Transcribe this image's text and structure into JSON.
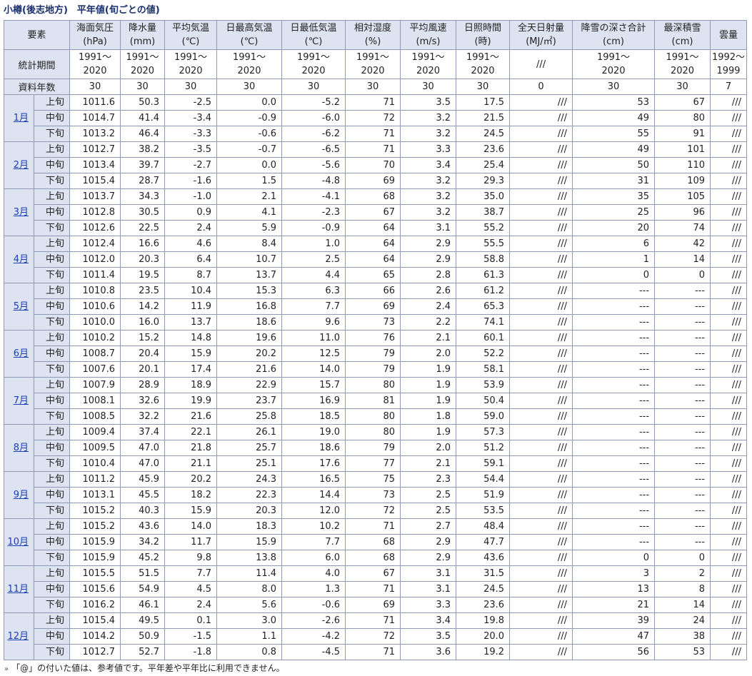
{
  "title": "小樽(後志地方)　平年値(旬ごとの値)",
  "header": {
    "element_label": "要素",
    "columns": [
      [
        "海面気圧",
        "(hPa)"
      ],
      [
        "降水量",
        "(mm)"
      ],
      [
        "平均気温",
        "(℃)"
      ],
      [
        "日最高気温",
        "(℃)"
      ],
      [
        "日最低気温",
        "(℃)"
      ],
      [
        "相対湿度",
        "(%)"
      ],
      [
        "平均風速",
        "(m/s)"
      ],
      [
        "日照時間",
        "(時)"
      ],
      [
        "全天日射量",
        "(MJ/㎡)"
      ],
      [
        "降雪の深さ合計",
        "(cm)"
      ],
      [
        "最深積雪",
        "(cm)"
      ],
      [
        "雲量",
        ""
      ]
    ]
  },
  "period": {
    "label": "統計期間",
    "values": [
      [
        "1991～",
        "2020"
      ],
      [
        "1991～",
        "2020"
      ],
      [
        "1991～",
        "2020"
      ],
      [
        "1991～",
        "2020"
      ],
      [
        "1991～",
        "2020"
      ],
      [
        "1991～",
        "2020"
      ],
      [
        "1991～",
        "2020"
      ],
      [
        "1991～",
        "2020"
      ],
      [
        "///",
        ""
      ],
      [
        "1991～",
        "2020"
      ],
      [
        "1991～",
        "2020"
      ],
      [
        "1992～",
        "1999"
      ]
    ]
  },
  "years": {
    "label": "資料年数",
    "values": [
      "30",
      "30",
      "30",
      "30",
      "30",
      "30",
      "30",
      "30",
      "0",
      "30",
      "30",
      "7"
    ]
  },
  "dekads": [
    "上旬",
    "中旬",
    "下旬"
  ],
  "months": [
    {
      "label": "1月",
      "rows": [
        [
          "1011.6",
          "50.3",
          "-2.5",
          "0.0",
          "-5.2",
          "71",
          "3.5",
          "17.5",
          "///",
          "53",
          "67",
          "///"
        ],
        [
          "1014.7",
          "41.4",
          "-3.4",
          "-0.9",
          "-6.0",
          "72",
          "3.2",
          "21.5",
          "///",
          "49",
          "80",
          "///"
        ],
        [
          "1013.2",
          "46.4",
          "-3.3",
          "-0.6",
          "-6.2",
          "71",
          "3.2",
          "24.5",
          "///",
          "55",
          "91",
          "///"
        ]
      ]
    },
    {
      "label": "2月",
      "rows": [
        [
          "1012.7",
          "38.2",
          "-3.5",
          "-0.7",
          "-6.5",
          "71",
          "3.3",
          "23.6",
          "///",
          "49",
          "101",
          "///"
        ],
        [
          "1013.4",
          "39.7",
          "-2.7",
          "0.0",
          "-5.6",
          "70",
          "3.4",
          "25.4",
          "///",
          "50",
          "110",
          "///"
        ],
        [
          "1015.4",
          "28.7",
          "-1.6",
          "1.5",
          "-4.8",
          "69",
          "3.2",
          "29.3",
          "///",
          "31",
          "109",
          "///"
        ]
      ]
    },
    {
      "label": "3月",
      "rows": [
        [
          "1013.7",
          "34.3",
          "-1.0",
          "2.1",
          "-4.1",
          "68",
          "3.2",
          "35.0",
          "///",
          "35",
          "105",
          "///"
        ],
        [
          "1012.8",
          "30.5",
          "0.9",
          "4.1",
          "-2.3",
          "67",
          "3.2",
          "38.7",
          "///",
          "25",
          "96",
          "///"
        ],
        [
          "1012.6",
          "22.5",
          "2.4",
          "5.9",
          "-0.9",
          "64",
          "3.1",
          "55.2",
          "///",
          "20",
          "74",
          "///"
        ]
      ]
    },
    {
      "label": "4月",
      "rows": [
        [
          "1012.4",
          "16.6",
          "4.6",
          "8.4",
          "1.0",
          "64",
          "2.9",
          "55.5",
          "///",
          "6",
          "42",
          "///"
        ],
        [
          "1012.0",
          "20.3",
          "6.4",
          "10.7",
          "2.5",
          "64",
          "2.9",
          "58.8",
          "///",
          "1",
          "14",
          "///"
        ],
        [
          "1011.4",
          "19.5",
          "8.7",
          "13.7",
          "4.4",
          "65",
          "2.8",
          "61.3",
          "///",
          "0",
          "0",
          "///"
        ]
      ]
    },
    {
      "label": "5月",
      "rows": [
        [
          "1010.8",
          "23.5",
          "10.4",
          "15.3",
          "6.3",
          "66",
          "2.6",
          "61.2",
          "///",
          "---",
          "---",
          "///"
        ],
        [
          "1010.6",
          "14.2",
          "11.9",
          "16.8",
          "7.7",
          "69",
          "2.4",
          "65.3",
          "///",
          "---",
          "---",
          "///"
        ],
        [
          "1010.0",
          "16.0",
          "13.7",
          "18.6",
          "9.6",
          "73",
          "2.2",
          "74.1",
          "///",
          "---",
          "---",
          "///"
        ]
      ]
    },
    {
      "label": "6月",
      "rows": [
        [
          "1010.2",
          "15.2",
          "14.8",
          "19.6",
          "11.0",
          "76",
          "2.1",
          "60.1",
          "///",
          "---",
          "---",
          "///"
        ],
        [
          "1008.7",
          "20.4",
          "15.9",
          "20.2",
          "12.5",
          "79",
          "2.0",
          "52.2",
          "///",
          "---",
          "---",
          "///"
        ],
        [
          "1007.6",
          "20.1",
          "17.4",
          "21.6",
          "14.0",
          "79",
          "1.9",
          "58.1",
          "///",
          "---",
          "---",
          "///"
        ]
      ]
    },
    {
      "label": "7月",
      "rows": [
        [
          "1007.9",
          "28.9",
          "18.9",
          "22.9",
          "15.7",
          "80",
          "1.9",
          "53.9",
          "///",
          "---",
          "---",
          "///"
        ],
        [
          "1008.1",
          "32.6",
          "19.9",
          "23.7",
          "16.9",
          "81",
          "1.9",
          "50.4",
          "///",
          "---",
          "---",
          "///"
        ],
        [
          "1008.5",
          "32.2",
          "21.6",
          "25.8",
          "18.5",
          "80",
          "1.8",
          "59.0",
          "///",
          "---",
          "---",
          "///"
        ]
      ]
    },
    {
      "label": "8月",
      "rows": [
        [
          "1009.4",
          "37.4",
          "22.1",
          "26.1",
          "19.0",
          "80",
          "1.9",
          "57.3",
          "///",
          "---",
          "---",
          "///"
        ],
        [
          "1009.5",
          "47.0",
          "21.8",
          "25.7",
          "18.6",
          "79",
          "2.0",
          "51.2",
          "///",
          "---",
          "---",
          "///"
        ],
        [
          "1010.4",
          "47.0",
          "21.1",
          "25.1",
          "17.6",
          "77",
          "2.1",
          "59.1",
          "///",
          "---",
          "---",
          "///"
        ]
      ]
    },
    {
      "label": "9月",
      "rows": [
        [
          "1011.2",
          "45.9",
          "20.2",
          "24.3",
          "16.5",
          "75",
          "2.3",
          "54.4",
          "///",
          "---",
          "---",
          "///"
        ],
        [
          "1013.1",
          "45.5",
          "18.2",
          "22.3",
          "14.4",
          "73",
          "2.5",
          "51.9",
          "///",
          "---",
          "---",
          "///"
        ],
        [
          "1015.2",
          "40.3",
          "15.9",
          "20.3",
          "12.0",
          "72",
          "2.5",
          "53.5",
          "///",
          "---",
          "---",
          "///"
        ]
      ]
    },
    {
      "label": "10月",
      "rows": [
        [
          "1015.2",
          "43.6",
          "14.0",
          "18.3",
          "10.2",
          "71",
          "2.7",
          "48.4",
          "///",
          "---",
          "---",
          "///"
        ],
        [
          "1015.9",
          "34.2",
          "11.7",
          "15.9",
          "7.7",
          "68",
          "2.9",
          "47.7",
          "///",
          "---",
          "---",
          "///"
        ],
        [
          "1015.9",
          "45.2",
          "9.8",
          "13.8",
          "6.0",
          "68",
          "2.9",
          "43.6",
          "///",
          "0",
          "0",
          "///"
        ]
      ]
    },
    {
      "label": "11月",
      "rows": [
        [
          "1015.5",
          "51.5",
          "7.7",
          "11.4",
          "4.0",
          "67",
          "3.1",
          "31.5",
          "///",
          "3",
          "2",
          "///"
        ],
        [
          "1015.6",
          "54.9",
          "4.5",
          "8.0",
          "1.3",
          "71",
          "3.1",
          "24.5",
          "///",
          "13",
          "8",
          "///"
        ],
        [
          "1016.2",
          "46.1",
          "2.4",
          "5.6",
          "-0.6",
          "69",
          "3.3",
          "23.6",
          "///",
          "21",
          "14",
          "///"
        ]
      ]
    },
    {
      "label": "12月",
      "rows": [
        [
          "1015.4",
          "49.5",
          "0.1",
          "3.0",
          "-2.6",
          "71",
          "3.4",
          "19.8",
          "///",
          "39",
          "24",
          "///"
        ],
        [
          "1014.2",
          "50.9",
          "-1.5",
          "1.1",
          "-4.2",
          "72",
          "3.5",
          "20.0",
          "///",
          "47",
          "38",
          "///"
        ],
        [
          "1012.7",
          "52.7",
          "-1.8",
          "0.8",
          "-4.5",
          "71",
          "3.6",
          "19.2",
          "///",
          "56",
          "53",
          "///"
        ]
      ]
    }
  ],
  "note": {
    "marker": "»",
    "text": "「@」の付いた値は、参考値です。平年差や平年比に利用できません。"
  }
}
